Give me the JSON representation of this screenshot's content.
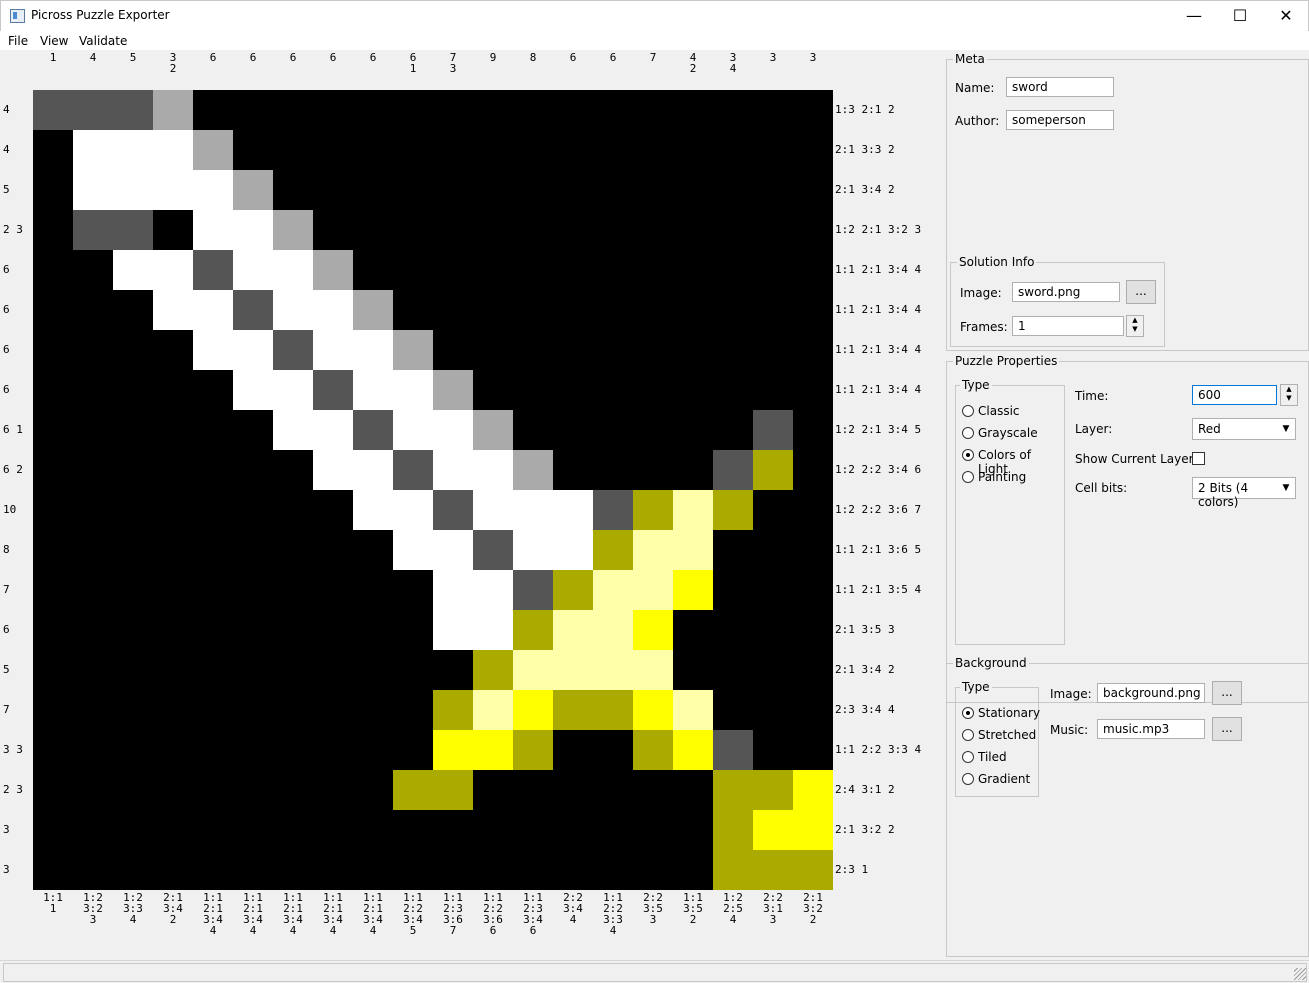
{
  "window": {
    "title": "Picross Puzzle Exporter",
    "minimize_glyph": "—",
    "maximize_glyph": "☐",
    "close_glyph": "✕"
  },
  "menu": [
    "File",
    "View",
    "Validate"
  ],
  "palette": {
    "K": "#000000",
    "D": "#555555",
    "L": "#aaaaaa",
    "W": "#ffffff",
    "O": "#aaaa00",
    "Y": "#ffff00",
    "P": "#ffffaa"
  },
  "grid_rows": [
    "DDDLKKKKKKKKKKKKKKKK",
    "KWWWLKKKKKKKKKKKKKKK",
    "KWWWWLKKKKKKKKKKKKKK",
    "KDDKWWLKKKKKKKKKKKKK",
    "KKWWDWWLKKKKKKKKKKKK",
    "KKKWWDWWLKKKKKKKKKKK",
    "KKKKWWDWWLKKKKKKKKKK",
    "KKKKKWWDWWLKKKKKKKKK",
    "KKKKKKWWDWWLKKKKKKDK",
    "KKKKKKKWWDWWLKKKKDOK",
    "KKKKKKKKWWDWWWDOPOKK",
    "KKKKKKKKKWWDWWOPPKKK",
    "KKKKKKKKKKWWDOPPYKKK",
    "KKKKKKKKKKWWOPPYKKKK",
    "KKKKKKKKKKKOPPPPKKKK",
    "KKKKKKKKKKOPYOOYPKKK",
    "KKKKKKKKKKYYOKKOYDKK",
    "KKKKKKKKKOOKKKKKKOOY",
    "KKKKKKKKKKKKKKKKKOYY",
    "KKKKKKKKKKKKKKKKKOOO"
  ],
  "col_clues_top": [
    "1",
    "4",
    "5",
    "3\n2",
    "6",
    "6",
    "6",
    "6",
    "6",
    "6\n1",
    "7\n3",
    "9",
    "8",
    "6",
    "6",
    "7",
    "4\n2",
    "3\n4",
    "3",
    "3"
  ],
  "row_clues_left": [
    "4",
    "4",
    "5",
    "2 3",
    "6",
    "6",
    "6",
    "6",
    "6 1",
    "6 2",
    "10",
    "8",
    "7",
    "6",
    "5",
    "7",
    "3 3",
    "2 3",
    "3",
    "3"
  ],
  "row_clues_right": [
    "1:3 2:1 2",
    "2:1 3:3 2",
    "2:1 3:4 2",
    "1:2 2:1 3:2 3",
    "1:1 2:1 3:4 4",
    "1:1 2:1 3:4 4",
    "1:1 2:1 3:4 4",
    "1:1 2:1 3:4 4",
    "1:2 2:1 3:4 5",
    "1:2 2:2 3:4 6",
    "1:2 2:2 3:6 7",
    "1:1 2:1 3:6 5",
    "1:1 2:1 3:5 4",
    "2:1 3:5 3",
    "2:1 3:4 2",
    "2:3 3:4 4",
    "1:1 2:2 3:3 4",
    "2:4 3:1 2",
    "2:1 3:2 2",
    "2:3 1"
  ],
  "col_clues_bottom": [
    "1:1\n1",
    "1:2\n3:2\n3",
    "1:2\n3:3\n4",
    "2:1\n3:4\n2",
    "1:1\n2:1\n3:4\n4",
    "1:1\n2:1\n3:4\n4",
    "1:1\n2:1\n3:4\n4",
    "1:1\n2:1\n3:4\n4",
    "1:1\n2:1\n3:4\n4",
    "1:1\n2:2\n3:4\n5",
    "1:1\n2:3\n3:6\n7",
    "1:1\n2:2\n3:6\n6",
    "1:1\n2:3\n3:4\n6",
    "2:2\n3:4\n4",
    "1:1\n2:2\n3:3\n4",
    "2:2\n3:5\n3",
    "1:1\n3:5\n2",
    "1:2\n2:5\n4",
    "2:2\n3:1\n3",
    "2:1\n3:2\n2"
  ],
  "meta": {
    "title": "Meta",
    "name_label": "Name:",
    "name_value": "sword",
    "author_label": "Author:",
    "author_value": "someperson"
  },
  "solution": {
    "title": "Solution Info",
    "image_label": "Image:",
    "image_value": "sword.png",
    "browse_label": "...",
    "frames_label": "Frames:",
    "frames_value": "1"
  },
  "props": {
    "title": "Puzzle Properties",
    "type_title": "Type",
    "types": [
      "Classic",
      "Grayscale",
      "Colors of Light",
      "Painting"
    ],
    "selected_type": "Colors of Light",
    "time_label": "Time:",
    "time_value": "600",
    "layer_label": "Layer:",
    "layer_value": "Red",
    "show_layer_label": "Show Current Layer:",
    "show_layer_checked": false,
    "cellbits_label": "Cell bits:",
    "cellbits_value": "2 Bits (4 colors)"
  },
  "background": {
    "title": "Background",
    "type_title": "Type",
    "types": [
      "Stationary",
      "Stretched",
      "Tiled",
      "Gradient"
    ],
    "selected_type": "Stationary",
    "image_label": "Image:",
    "image_value": "background.png",
    "music_label": "Music:",
    "music_value": "music.mp3",
    "browse_label": "..."
  }
}
